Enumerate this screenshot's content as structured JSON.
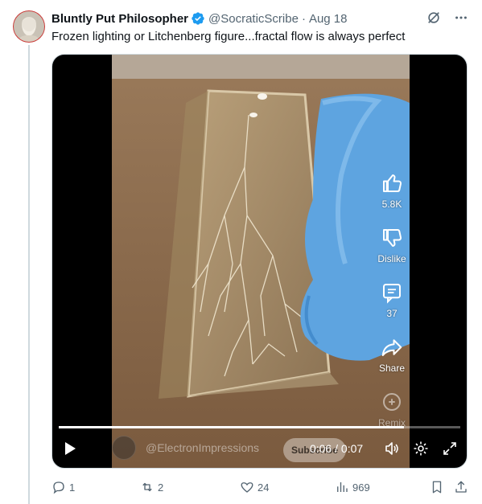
{
  "tweet": {
    "author_name": "Bluntly Put Philosopher",
    "handle": "@SocraticScribe",
    "separator": "·",
    "date": "Aug 18",
    "text": "Frozen lighting or Litchenberg figure...fractal flow is always perfect"
  },
  "video": {
    "likes": "5.8K",
    "dislike_label": "Dislike",
    "comments": "37",
    "share_label": "Share",
    "remix_label": "Remix",
    "channel_name": "@ElectronImpressions",
    "subscribe_label": "Subscribe",
    "time_display": "0:06 / 0:07",
    "progress": 0.86
  },
  "actions": {
    "replies": "1",
    "reposts": "2",
    "likes": "24",
    "views": "969"
  },
  "colors": {
    "verified": "#1d9bf0",
    "muted_text": "#536471",
    "thread_line": "#cfd9de"
  }
}
